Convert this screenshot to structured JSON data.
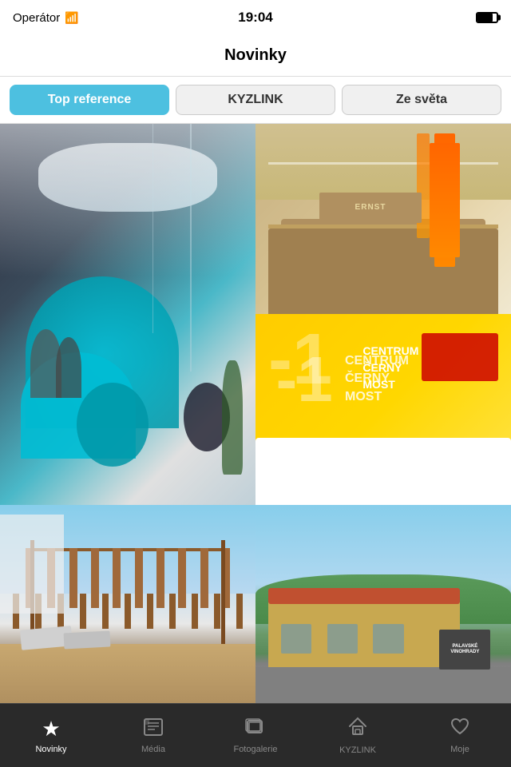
{
  "status_bar": {
    "carrier": "Operátor",
    "time": "19:04",
    "battery_level": 80
  },
  "header": {
    "title": "Novinky"
  },
  "tabs": [
    {
      "id": "top-reference",
      "label": "Top reference",
      "active": true
    },
    {
      "id": "kyzlink",
      "label": "KYZLINK",
      "active": false
    },
    {
      "id": "ze-sveta",
      "label": "Ze světa",
      "active": false
    }
  ],
  "grid": {
    "items": [
      {
        "id": "office-blue",
        "alt": "Modern office with teal sofa",
        "span": "large"
      },
      {
        "id": "reception",
        "alt": "Reception desk with orange pillars",
        "span": "small"
      },
      {
        "id": "yellow-centrum",
        "alt": "Centrum Cerny Most yellow wall",
        "span": "small"
      },
      {
        "id": "pergola",
        "alt": "Wooden pergola with sunbeds",
        "span": "small"
      },
      {
        "id": "building",
        "alt": "Palavske Vinohrady building exterior",
        "span": "small"
      }
    ]
  },
  "bottom_nav": {
    "items": [
      {
        "id": "novinky",
        "label": "Novinky",
        "icon": "star",
        "active": true
      },
      {
        "id": "media",
        "label": "Média",
        "icon": "newspaper",
        "active": false
      },
      {
        "id": "fotogalerie",
        "label": "Fotogalerie",
        "icon": "gallery",
        "active": false
      },
      {
        "id": "kyzlink",
        "label": "KYZLINK",
        "icon": "home",
        "active": false
      },
      {
        "id": "moje",
        "label": "Moje",
        "icon": "heart",
        "active": false
      }
    ]
  }
}
